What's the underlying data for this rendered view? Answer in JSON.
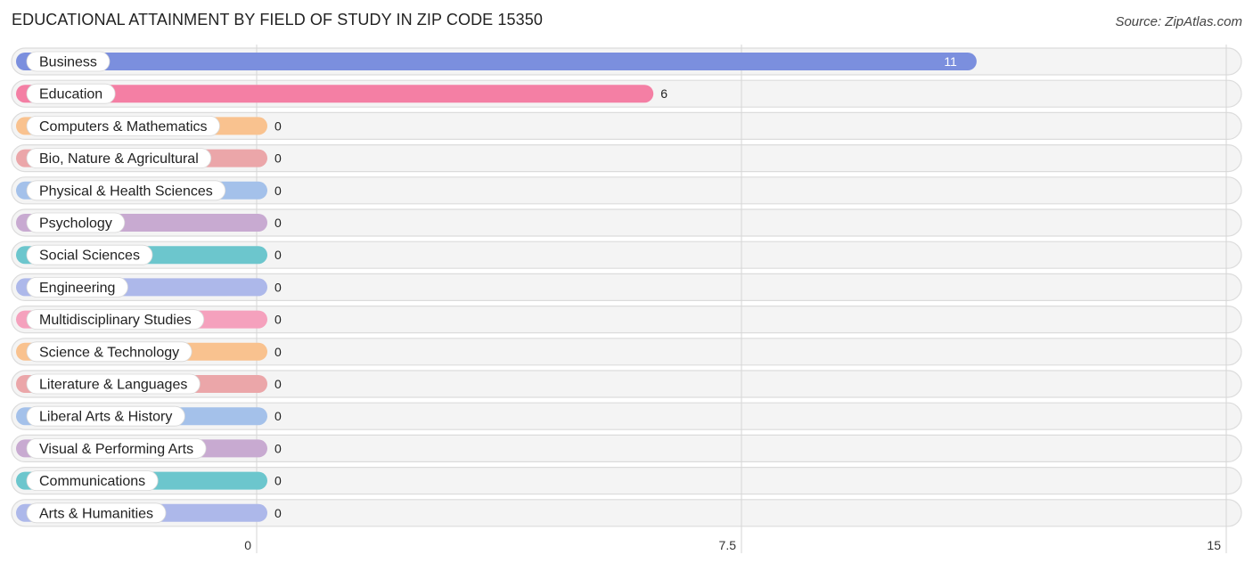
{
  "header": {
    "title": "EDUCATIONAL ATTAINMENT BY FIELD OF STUDY IN ZIP CODE 15350",
    "source": "Source: ZipAtlas.com"
  },
  "chart_data": {
    "type": "bar",
    "orientation": "horizontal",
    "title": "EDUCATIONAL ATTAINMENT BY FIELD OF STUDY IN ZIP CODE 15350",
    "xlabel": "",
    "ylabel": "",
    "xlim": [
      0,
      15
    ],
    "xticks": [
      0,
      7.5,
      15
    ],
    "xtick_labels": [
      "0",
      "7.5",
      "15"
    ],
    "grid": true,
    "categories": [
      "Business",
      "Education",
      "Computers & Mathematics",
      "Bio, Nature & Agricultural",
      "Physical & Health Sciences",
      "Psychology",
      "Social Sciences",
      "Engineering",
      "Multidisciplinary Studies",
      "Science & Technology",
      "Literature & Languages",
      "Liberal Arts & History",
      "Visual & Performing Arts",
      "Communications",
      "Arts & Humanities"
    ],
    "values": [
      11,
      6,
      0,
      0,
      0,
      0,
      0,
      0,
      0,
      0,
      0,
      0,
      0,
      0,
      0
    ],
    "colors": [
      "#7b8fde",
      "#f47fa4",
      "#f9c28f",
      "#eba6a9",
      "#a4c1ea",
      "#c8aad1",
      "#6cc6cd",
      "#adb8ea",
      "#f5a1bd",
      "#f9c28f",
      "#eba6a9",
      "#a4c1ea",
      "#c8aad1",
      "#6cc6cd",
      "#adb8ea"
    ]
  }
}
